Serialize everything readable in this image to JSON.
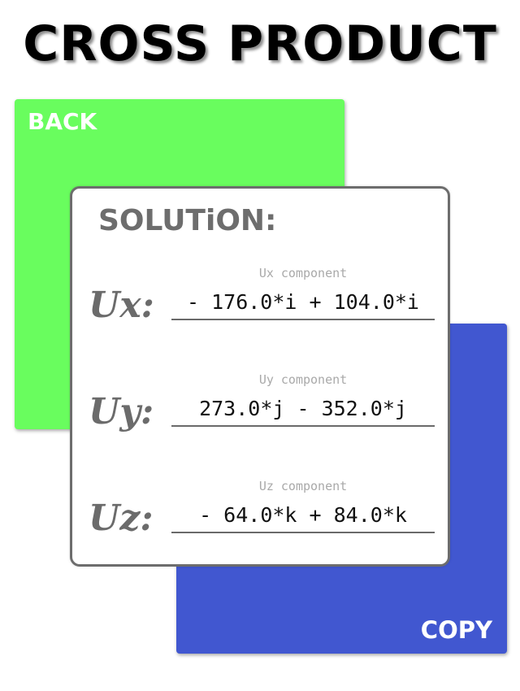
{
  "app": {
    "title": "CROSS PRODUCT"
  },
  "buttons": {
    "back_label": "BACK",
    "copy_label": "COPY"
  },
  "solution": {
    "title": "SOLUTiON:",
    "rows": [
      {
        "label": "Ux:",
        "hint": "Ux component",
        "value": "- 176.0*i + 104.0*i"
      },
      {
        "label": "Uy:",
        "hint": "Uy component",
        "value": "273.0*j - 352.0*j"
      },
      {
        "label": "Uz:",
        "hint": "Uz component",
        "value": "- 64.0*k + 84.0*k"
      }
    ]
  },
  "colors": {
    "back_panel": "#69fd5e",
    "copy_panel": "#4157d0",
    "card_border": "#6d6d6d",
    "label_text": "#6b6b6b",
    "hint_text": "#a9a9a9"
  }
}
